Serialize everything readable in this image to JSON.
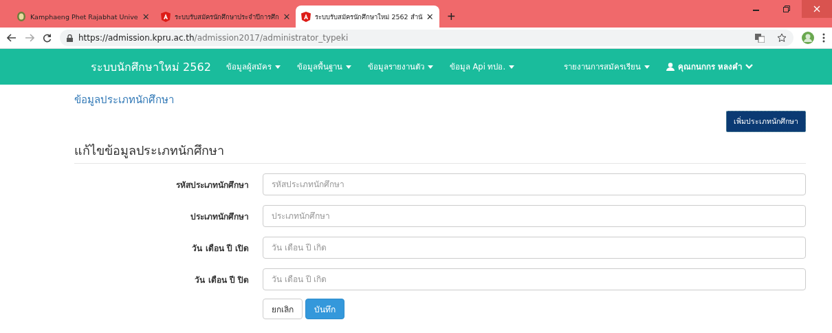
{
  "browser": {
    "tabs": [
      {
        "title": "Kamphaeng Phet Rajabhat Unive",
        "kind": "seal",
        "close": "✕",
        "selected": false
      },
      {
        "title": "ระบบรับสมัครนักศึกษาประจำปีการศึก",
        "kind": "shield",
        "close": "✕",
        "selected": false
      },
      {
        "title": "ระบบรับสมัครนักศึกษาใหม่ 2562 สำนั",
        "kind": "shield",
        "close": "✕",
        "selected": true
      }
    ],
    "new_tab": "+",
    "url_host": "https://admission.kpru.ac.th",
    "url_path": "/admission2017/administrator_typeki"
  },
  "navbar": {
    "brand": "ระบบนักศึกษาใหม่ 2562",
    "menus": [
      "ข้อมูลผู้สมัคร",
      "ข้อมูลพื้นฐาน",
      "ข้อมูลรายงานตัว",
      "ข้อมูล Api ทปอ."
    ],
    "right_menu": "รายงานการสมัครเรียน",
    "user": "คุณกนกกร หลงคำ"
  },
  "page_title": "ข้อมูลประเภทนักศึกษา",
  "add_button": "เพิ่มประเภทนักศึกษา",
  "form": {
    "heading": "แก้ไขข้อมูลประเภทนักศึกษา",
    "fields": [
      {
        "label": "รหัสประเภทนักศึกษา",
        "placeholder": "รหัสประเภทนักศึกษา"
      },
      {
        "label": "ประเภทนักศึกษา",
        "placeholder": "ประเภทนักศึกษา"
      },
      {
        "label": "วัน เดือน ปี เปิด",
        "placeholder": "วัน เดือน ปี เกิด"
      },
      {
        "label": "วัน เดือน ปี ปิด",
        "placeholder": "วัน เดือน ปี เกิด"
      }
    ],
    "cancel": "ยกเลิก",
    "save": "บันทึก"
  }
}
